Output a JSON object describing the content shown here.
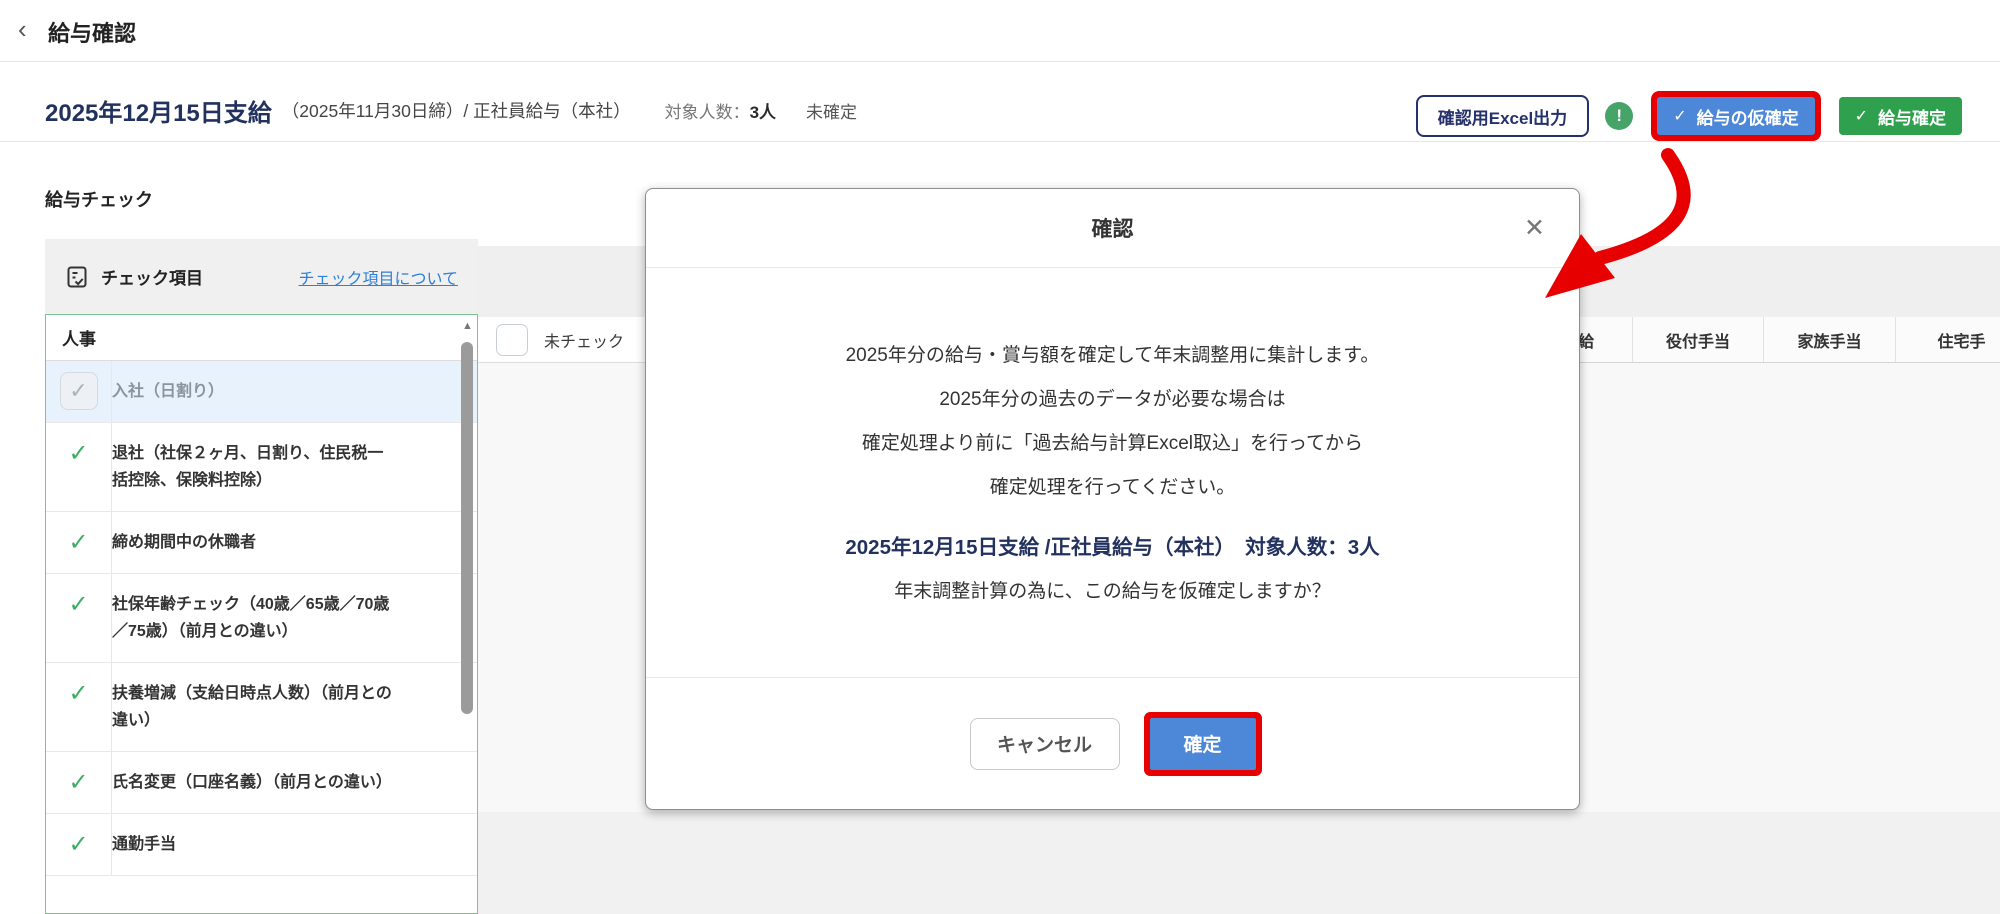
{
  "icons": {
    "back": "‹",
    "check": "✓",
    "close": "✕",
    "alert": "!",
    "scroll_up": "▲"
  },
  "topbar": {
    "title": "給与確認"
  },
  "header": {
    "payday": "2025年12月15日支給",
    "payday_detail": "（2025年11月30日締）/ 正社員給与（本社）",
    "target_label": "対象人数：",
    "target_count": "3人",
    "status": "未確定",
    "excel_button": "確認用Excel出力",
    "provisional_button": "給与の仮確定",
    "finalize_button": "給与確定"
  },
  "check_panel": {
    "title": "給与チェック",
    "header_label": "チェック項目",
    "header_link": "チェック項目について",
    "section": "人事",
    "items": [
      {
        "label": "入社（日割り）",
        "state": "muted-selected"
      },
      {
        "label": "退社（社保２ヶ月、日割り、住民税一括控除、保険料控除）",
        "state": "checked"
      },
      {
        "label": "締め期間中の休職者",
        "state": "checked"
      },
      {
        "label": "社保年齢チェック（40歳／65歳／70歳／75歳）（前月との違い）",
        "state": "checked"
      },
      {
        "label": "扶養増減（支給日時点人数）（前月との違い）",
        "state": "checked"
      },
      {
        "label": "氏名変更（口座名義）（前月との違い）",
        "state": "checked"
      },
      {
        "label": "通勤手当",
        "state": "checked"
      }
    ]
  },
  "table": {
    "filter_label": "未チェック",
    "columns": [
      "給",
      "役付手当",
      "家族手当",
      "住宅手"
    ]
  },
  "modal": {
    "title": "確認",
    "body_lines": [
      "2025年分の給与・賞与額を確定して年末調整用に集計します。",
      "2025年分の過去のデータが必要な場合は",
      "確定処理より前に「過去給与計算Excel取込」を行ってから",
      "確定処理を行ってください。"
    ],
    "summary": "2025年12月15日支給 /正社員給与（本社）　対象人数：3人",
    "question": "年末調整計算の為に、この給与を仮確定しますか？",
    "cancel_button": "キャンセル",
    "ok_button": "確定"
  },
  "colors": {
    "accent_blue": "#4c87d8",
    "confirm_green": "#2fa04e",
    "annotation_red": "#e60000",
    "link_blue": "#2e7fd8",
    "check_green": "#3cb061",
    "navy_text": "#22315e",
    "panel_border_green": "#7cc294",
    "selected_row_bg": "#e8f2fc"
  }
}
